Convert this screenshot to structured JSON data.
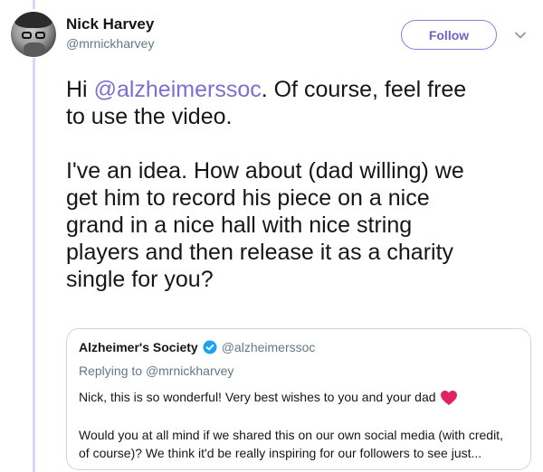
{
  "tweet": {
    "author_name": "Nick Harvey",
    "author_handle": "@mrnickharvey",
    "follow_label": "Follow",
    "text_prefix": "Hi ",
    "mention": "@alzheimerssoc",
    "text_line1_rest": ". Of course, feel free",
    "text_line2": "to use the video.",
    "paragraph2": "I've an idea. How about (dad willing) we\nget him to record his piece on a nice\ngrand in a nice hall with nice string\nplayers and then release it as a charity\nsingle for you?"
  },
  "quoted_tweet": {
    "author_name": "Alzheimer's Society",
    "author_handle": "@alzheimerssoc",
    "replying_label": "Replying to",
    "replying_to": "@mrnickharvey",
    "body1": "Nick, this is so wonderful! Very best wishes to you and your dad",
    "body2": "Would you at all mind if we shared this on our own social media (with credit,\nof course)? We think it'd be really inspiring for our followers to see just..."
  },
  "icons": {
    "verified": "verified-badge-icon",
    "heart": "red-heart-icon",
    "caret": "chevron-down-icon"
  },
  "colors": {
    "accent": "#7a6fd2",
    "verified_blue": "#1da1f2",
    "heart_red": "#e0245e",
    "thread_line": "#d6d8f5"
  }
}
